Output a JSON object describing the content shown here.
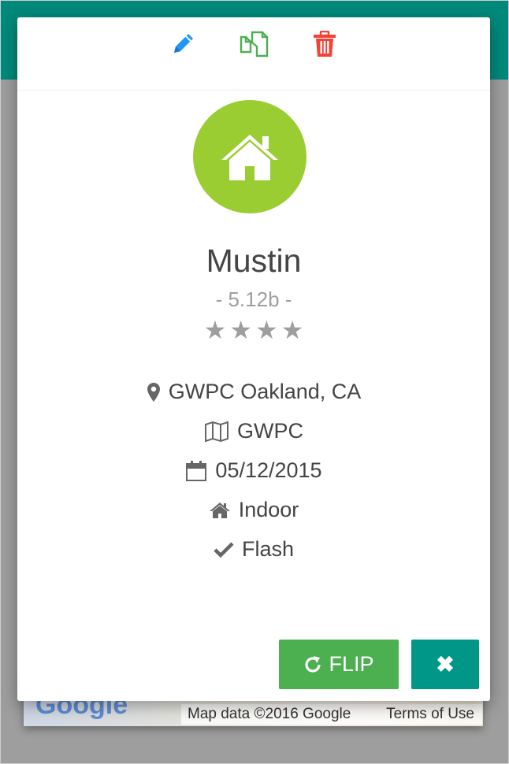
{
  "toolbar": {
    "edit_icon": "pencil-icon",
    "copy_icon": "copy-icon",
    "delete_icon": "trash-icon",
    "colors": {
      "edit": "#2196f3",
      "copy": "#4caf50",
      "delete": "#f44336"
    }
  },
  "route": {
    "avatar_icon": "home-icon",
    "avatar_color": "#9acd32",
    "name": "Mustin",
    "grade": "- 5.12b -",
    "stars": 4
  },
  "details": {
    "location": "GWPC Oakland, CA",
    "area": "GWPC",
    "date": "05/12/2015",
    "type": "Indoor",
    "style": "Flash"
  },
  "buttons": {
    "flip_label": "FLIP",
    "close_symbol": "✖"
  },
  "map": {
    "logo": "Google",
    "attribution": "Map data ©2016 Google",
    "terms": "Terms of Use"
  }
}
